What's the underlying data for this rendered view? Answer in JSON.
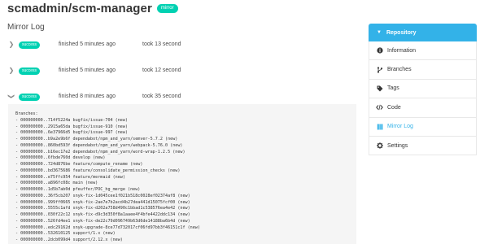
{
  "repo": {
    "title": "scmadmin/scm-manager",
    "tag": "mirror"
  },
  "page": {
    "subtitle": "Mirror Log"
  },
  "log_entries": [
    {
      "status": "success",
      "finished": "finished 5 minutes ago",
      "took": "took 13 second",
      "expanded": false
    },
    {
      "status": "success",
      "finished": "finished 5 minutes ago",
      "took": "took 12 second",
      "expanded": false
    },
    {
      "status": "success",
      "finished": "finished 8 minutes ago",
      "took": "took 35 second",
      "expanded": true
    }
  ],
  "log_lines": [
    "Branches:",
    "- 000000000..714f5224a bugfix/issue-704 (new)",
    "- 000000000..2915a65da bugfix/issue-910 (new)",
    "- 000000000..6e37966d5 bugfix/issue-997 (new)",
    "- 000000000..b9a2e9b6f dependabot/npm_and_yarn/semver-5.7.2 (new)",
    "- 000000000..860bd593f dependabot/npm_and_yarn/webpack-5.76.0 (new)",
    "- 000000000..b16ec17e2 dependabot/npm_and_yarn/word-wrap-1.2.5 (new)",
    "- 000000000..6fbde760d develop (new)",
    "- 000000000..724d876be feature/compute_rename (new)",
    "- 000000000..bd3675686 feature/consolidate_permission_checks (new)",
    "- 000000000..e75ffc954 feature/mermaid (new)",
    "- 000000000..a896fc08c main (new)",
    "- 000000000..1d5b7ab0d pfeuffer/POC_hg_merge (new)",
    "- 000000000..36f5cb207 snyk-fix-1d045cee1f021b518c0028ef02374af8 (new)",
    "- 000000000..999ff0665 snyk-fix-2ae7e7b2acd4b27dea441d15075fcf00 (new)",
    "- 000000000..5555c1afd snyk-fix-d202a758d490c1bbad1c538576ea4e42 (new)",
    "- 000000000..030f22c12 snyk-fix-d9c3d350f8a1aaee4f4bfe4422ddc134 (new)",
    "- 000000000..526fd4ee1 snyk-fix-de22c79d096749b63d6de14188ba6b4d (new)",
    "- 000000000..edc29162d snyk-upgrade-8ce77d732017cf06fd97bb3f46151c1f (new)",
    "- 000000000..532610125 support/1.x (new)",
    "- 000000000..2dcb099d4 support/2.12.x (new)"
  ],
  "sidebar": {
    "header": "Repository",
    "items": [
      {
        "label": "Information",
        "icon": "info-circle-icon"
      },
      {
        "label": "Branches",
        "icon": "code-branch-icon"
      },
      {
        "label": "Tags",
        "icon": "tags-icon"
      },
      {
        "label": "Code",
        "icon": "code-icon"
      },
      {
        "label": "Mirror Log",
        "icon": "mirror-log-icon",
        "active": true
      },
      {
        "label": "Settings",
        "icon": "gear-icon"
      }
    ]
  },
  "colors": {
    "accent": "#33b2e8",
    "success": "#00d1b2",
    "log_bg": "#f5f5f5"
  }
}
